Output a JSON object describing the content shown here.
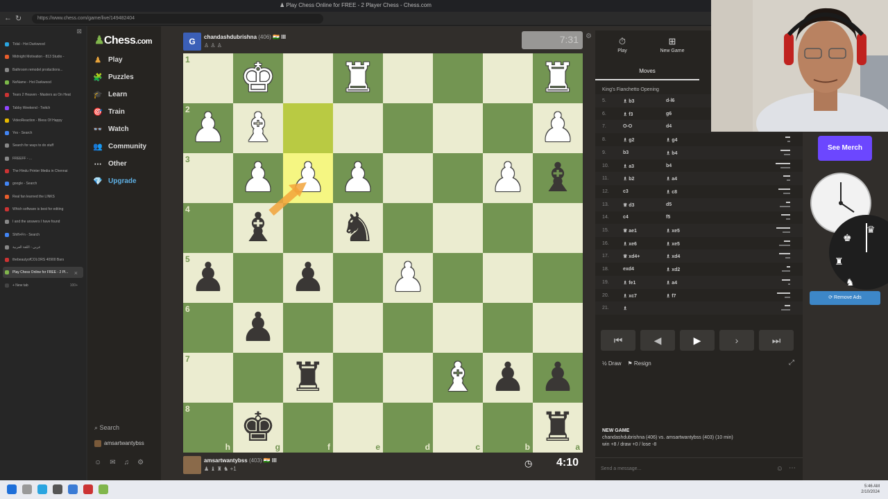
{
  "browser": {
    "window_title": "♟ Play Chess Online for FREE - 2 Player Chess - Chess.com",
    "url": "https://www.chess.com/game/live/149482404",
    "tabs": [
      {
        "label": "Tidal - Hot Darkwood",
        "color": "#2aa5e0"
      },
      {
        "label": "Midnight Motivation - 813 Studio -",
        "color": "#e85d2c"
      },
      {
        "label": "Bathroom remodel productions...",
        "color": "#888888"
      },
      {
        "label": "NoName - Hot Darkwood",
        "color": "#7cba49"
      },
      {
        "label": "Tears 2 Heaven - Masters as On Heat",
        "color": "#c33"
      },
      {
        "label": "Tabby Weekend - Twitch",
        "color": "#9146ff"
      },
      {
        "label": "VideoReaction - Bless Of Happy",
        "color": "#e6b800"
      },
      {
        "label": "Yes - Search",
        "color": "#4285f4"
      },
      {
        "label": "Search for ways to do stuff",
        "color": "#888888"
      },
      {
        "label": "FREEFF - ...",
        "color": "#888888"
      },
      {
        "label": "The Hindu Printer Media in Chennai",
        "color": "#c33"
      },
      {
        "label": "google - Search",
        "color": "#4285f4"
      },
      {
        "label": "Real fan learned the LINKS",
        "color": "#e85d2c"
      },
      {
        "label": "Which software is best for editing",
        "color": "#c33"
      },
      {
        "label": "I and the answers I have found",
        "color": "#888888"
      },
      {
        "label": "Shift+Fn - Search",
        "color": "#4285f4"
      },
      {
        "label": "عربي - اللغة العربية",
        "color": "#888888"
      },
      {
        "label": "thebeautyofCOLORS 40900 Bars",
        "color": "#c33"
      },
      {
        "label": "Play Chess Online for FREE - 2 Pl...",
        "color": "#81b64c"
      },
      {
        "label": "+ New tab",
        "color": "#444444"
      }
    ],
    "tab_count_badge": "100+"
  },
  "sidebar": {
    "logo_text": "Chess",
    "logo_suffix": ".com",
    "items": [
      {
        "label": "Play",
        "icon": "♟",
        "color": "#e8a33a"
      },
      {
        "label": "Puzzles",
        "icon": "🧩",
        "color": "#e8743a"
      },
      {
        "label": "Learn",
        "icon": "🎓",
        "color": "#5fb0e4"
      },
      {
        "label": "Train",
        "icon": "🎯",
        "color": "#e86a3a"
      },
      {
        "label": "Watch",
        "icon": "👓",
        "color": "#ddd"
      },
      {
        "label": "Community",
        "icon": "👥",
        "color": "#5fb0e4"
      },
      {
        "label": "Other",
        "icon": "⋯",
        "color": "#ddd"
      },
      {
        "label": "Upgrade",
        "icon": "💎",
        "color": "#5fb0e4"
      }
    ],
    "search_label": "Search",
    "user_label": "amsartwantybss"
  },
  "top_player": {
    "avatar_letter": "G",
    "name": "chandashdubrishna",
    "rating": "(406)",
    "flags": "🇮🇳 III",
    "captured": "♙ ♙ ♙",
    "clock": "7:31"
  },
  "bottom_player": {
    "name": "amsartwantybss",
    "rating": "(403)",
    "flags": "🇮🇳 III",
    "captured": "♟ ♝ ♜ ♞ +1",
    "clock": "4:10"
  },
  "board": {
    "rank_labels": [
      "1",
      "2",
      "3",
      "4",
      "5",
      "6",
      "7",
      "8"
    ],
    "file_labels": [
      "h",
      "g",
      "f",
      "e",
      "d",
      "c",
      "b",
      "a"
    ],
    "highlight": [
      {
        "r": 1,
        "c": 2
      },
      {
        "r": 2,
        "c": 2
      }
    ],
    "pieces": [
      {
        "r": 0,
        "c": 1,
        "g": "♚",
        "s": "w"
      },
      {
        "r": 0,
        "c": 3,
        "g": "♜",
        "s": "w"
      },
      {
        "r": 0,
        "c": 7,
        "g": "♜",
        "s": "w"
      },
      {
        "r": 1,
        "c": 0,
        "g": "♟",
        "s": "w"
      },
      {
        "r": 1,
        "c": 1,
        "g": "♝",
        "s": "w"
      },
      {
        "r": 1,
        "c": 7,
        "g": "♟",
        "s": "w"
      },
      {
        "r": 2,
        "c": 1,
        "g": "♟",
        "s": "w"
      },
      {
        "r": 2,
        "c": 2,
        "g": "♟",
        "s": "w"
      },
      {
        "r": 2,
        "c": 3,
        "g": "♟",
        "s": "w"
      },
      {
        "r": 2,
        "c": 6,
        "g": "♟",
        "s": "w"
      },
      {
        "r": 2,
        "c": 7,
        "g": "♝",
        "s": "b"
      },
      {
        "r": 3,
        "c": 1,
        "g": "♝",
        "s": "b"
      },
      {
        "r": 3,
        "c": 3,
        "g": "♞",
        "s": "b"
      },
      {
        "r": 4,
        "c": 0,
        "g": "♟",
        "s": "b"
      },
      {
        "r": 4,
        "c": 2,
        "g": "♟",
        "s": "b"
      },
      {
        "r": 4,
        "c": 4,
        "g": "♟",
        "s": "w"
      },
      {
        "r": 5,
        "c": 1,
        "g": "♟",
        "s": "b"
      },
      {
        "r": 6,
        "c": 2,
        "g": "♜",
        "s": "b"
      },
      {
        "r": 6,
        "c": 5,
        "g": "♝",
        "s": "w"
      },
      {
        "r": 6,
        "c": 6,
        "g": "♟",
        "s": "b"
      },
      {
        "r": 6,
        "c": 7,
        "g": "♟",
        "s": "b"
      },
      {
        "r": 7,
        "c": 1,
        "g": "♚",
        "s": "b"
      },
      {
        "r": 7,
        "c": 7,
        "g": "♜",
        "s": "b"
      }
    ]
  },
  "panel": {
    "tab_play": "Play",
    "tab_new_game": "New Game",
    "moves_tab": "Moves",
    "opening": "King's Fianchetto Opening",
    "moves": [
      {
        "n": "5.",
        "w": "♗ b3",
        "b": "d-l6"
      },
      {
        "n": "6.",
        "w": "♗ f3",
        "b": "g6"
      },
      {
        "n": "7.",
        "w": "O-O",
        "b": "d4"
      },
      {
        "n": "8.",
        "w": "♗ g2",
        "b": "♗ g4"
      },
      {
        "n": "9.",
        "w": "b3",
        "b": "♗ b4"
      },
      {
        "n": "10.",
        "w": "♗ a3",
        "b": "b4"
      },
      {
        "n": "11.",
        "w": "♗ b2",
        "b": "♗ a4"
      },
      {
        "n": "12.",
        "w": "c3",
        "b": "♗ c8"
      },
      {
        "n": "13.",
        "w": "♕ d3",
        "b": "d5"
      },
      {
        "n": "14.",
        "w": "c4",
        "b": "f5"
      },
      {
        "n": "15.",
        "w": "♕ ae1",
        "b": "♗ xe5"
      },
      {
        "n": "16.",
        "w": "♗ xe6",
        "b": "♗ xe5"
      },
      {
        "n": "17.",
        "w": "♕ xd4+",
        "b": "♗ xd4"
      },
      {
        "n": "18.",
        "w": "exd4",
        "b": "♗ xd2"
      },
      {
        "n": "19.",
        "w": "♗ fe1",
        "b": "♗ a4"
      },
      {
        "n": "20.",
        "w": "♗ xc7",
        "b": "♗ f7"
      },
      {
        "n": "21.",
        "w": "♗",
        "b": ""
      }
    ],
    "nav_buttons": [
      "⏮",
      "◀",
      "▶",
      "›",
      "⏭"
    ],
    "draw_label": "½ Draw",
    "resign_label": "⚑ Resign",
    "new_game_title": "NEW GAME",
    "new_game_line1": "chandashdubrishna (406) vs. amsartwantybss (403) (10 min)",
    "new_game_line2": "win +8 / draw +0 / lose -8",
    "message_placeholder": "Send a message..."
  },
  "ads": {
    "merch_label": "See Merch",
    "remove_ads_label": "⟳ Remove Ads"
  },
  "taskbar": {
    "time": "5:46 AM",
    "date": "2/10/2024"
  }
}
